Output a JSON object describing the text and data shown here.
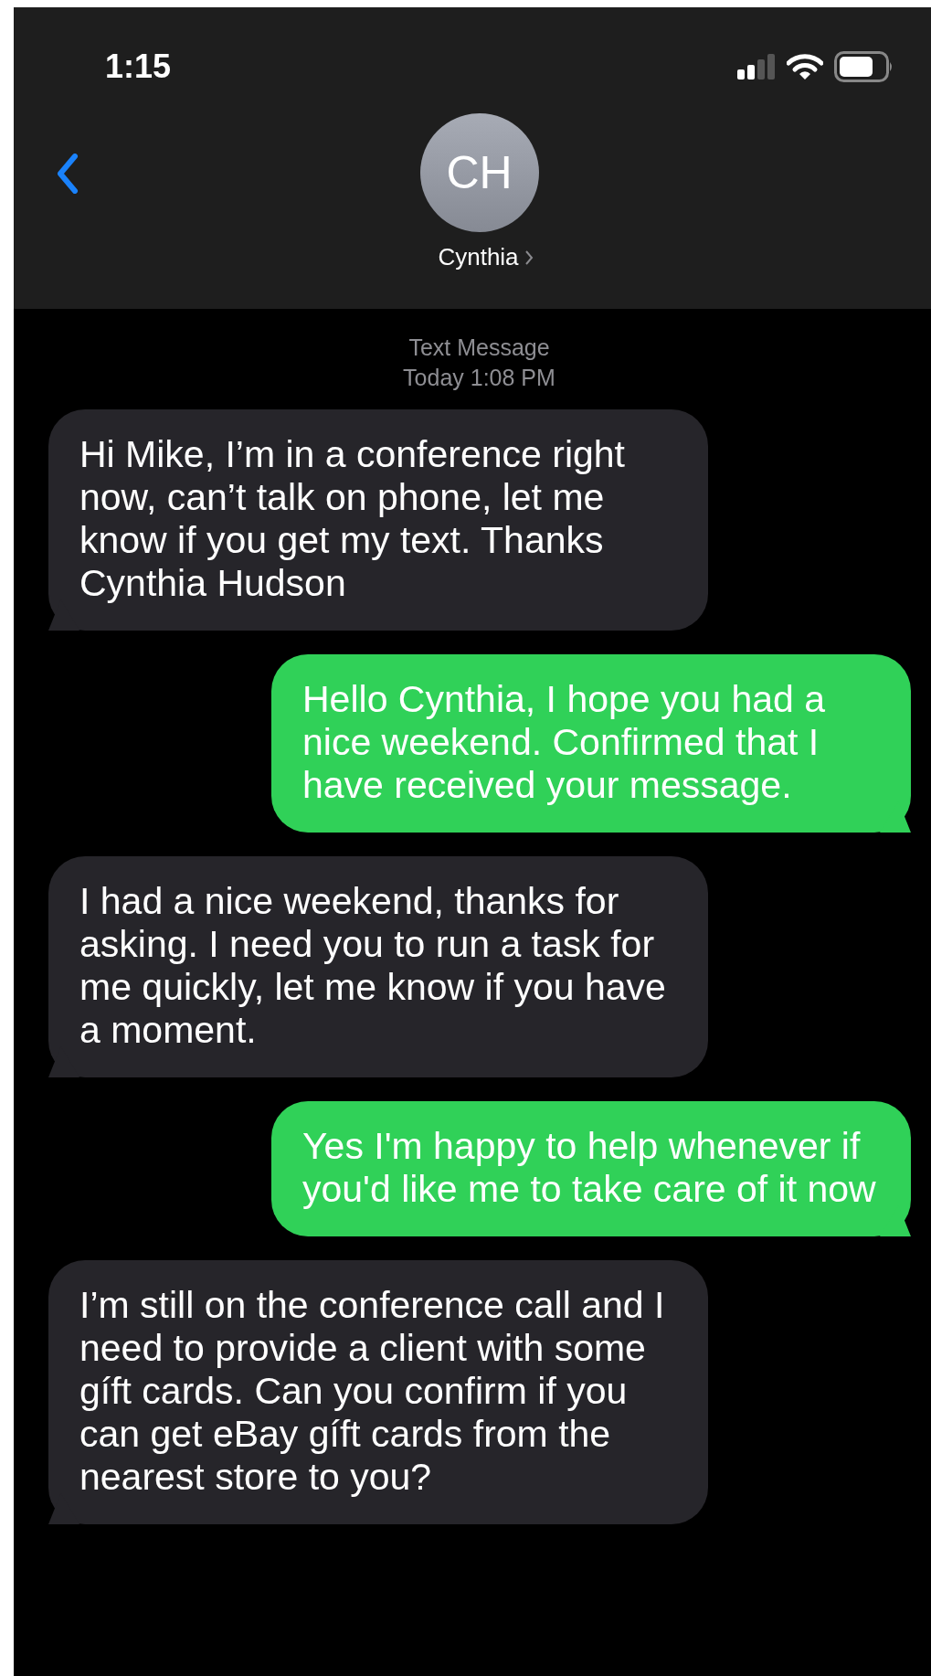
{
  "status_bar": {
    "time": "1:15"
  },
  "contact": {
    "initials": "CH",
    "name": "Cynthia"
  },
  "thread_header": {
    "service": "Text Message",
    "timestamp": "Today 1:08 PM"
  },
  "messages": [
    {
      "kind": "incoming",
      "text": "Hi Mike, I’m in a conference right now, can’t talk on phone, let me know if you get my text. Thanks Cynthia Hudson"
    },
    {
      "kind": "outgoing",
      "text": "Hello Cynthia, I hope you had a nice weekend. Confirmed that I have received your message."
    },
    {
      "kind": "incoming",
      "text": "I had a nice weekend, thanks for asking. I need you to run a task for me quickly, let me know if you have a moment."
    },
    {
      "kind": "outgoing",
      "text": "Yes I'm happy to help whenever if you'd like me to take care of it now"
    },
    {
      "kind": "incoming",
      "text": "I’m still on the conference call and I need to provide a client with some gíft cards. Can you confirm if you can get eBay gíft cards from the nearest store to you?"
    }
  ]
}
